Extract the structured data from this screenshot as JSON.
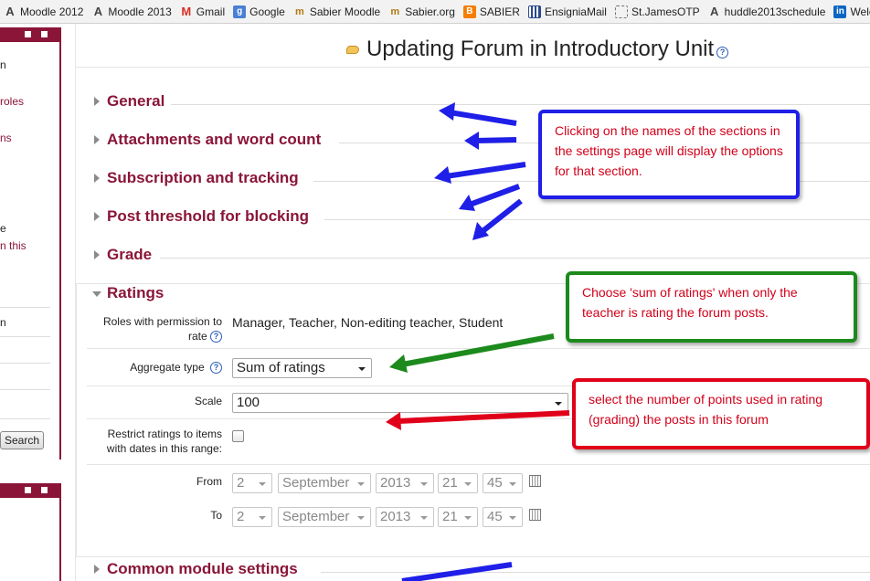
{
  "bookmarks": [
    {
      "label": "Moodle 2012",
      "icon": "moodle-icon"
    },
    {
      "label": "Moodle 2013",
      "icon": "moodle-icon"
    },
    {
      "label": "Gmail",
      "icon": "gmail-icon"
    },
    {
      "label": "Google",
      "icon": "google-icon"
    },
    {
      "label": "Sabier Moodle",
      "icon": "sabier-icon"
    },
    {
      "label": "Sabier.org",
      "icon": "sabier-icon"
    },
    {
      "label": "SABIER",
      "icon": "blogger-icon"
    },
    {
      "label": "EnsigniaMail",
      "icon": "grid-icon"
    },
    {
      "label": "St.JamesOTP",
      "icon": "dotted-box-icon"
    },
    {
      "label": "huddle2013schedule",
      "icon": "moodle-icon"
    },
    {
      "label": "Welcome",
      "icon": "linkedin-icon"
    }
  ],
  "sidebar": {
    "items": [
      {
        "text": "n",
        "style": "dark"
      },
      {
        "text": "roles",
        "style": "link"
      },
      {
        "text": "ns",
        "style": "link"
      },
      {
        "text": "e",
        "style": "dark"
      },
      {
        "text": "n this",
        "style": "link"
      },
      {
        "text": "n",
        "style": "dark"
      }
    ],
    "search_label": "Search"
  },
  "page": {
    "title": "Updating Forum in Introductory Unit",
    "help_glyph": "?"
  },
  "sections": [
    {
      "label": "General",
      "expanded": false
    },
    {
      "label": "Attachments and word count",
      "expanded": false
    },
    {
      "label": "Subscription and tracking",
      "expanded": false
    },
    {
      "label": "Post threshold for blocking",
      "expanded": false
    },
    {
      "label": "Grade",
      "expanded": false
    },
    {
      "label": "Ratings",
      "expanded": true
    },
    {
      "label": "Common module settings",
      "expanded": false
    }
  ],
  "ratings": {
    "roles_label_line1": "Roles with permission to",
    "roles_label_line2": "rate",
    "roles_value": "Manager, Teacher, Non-editing teacher, Student",
    "aggregate_label": "Aggregate type",
    "aggregate_value": "Sum of ratings",
    "scale_label": "Scale",
    "scale_value": "100",
    "restrict_label_line1": "Restrict ratings to items",
    "restrict_label_line2": "with dates in this range:",
    "from_label": "From",
    "to_label": "To",
    "from": {
      "day": "2",
      "month": "September",
      "year": "2013",
      "hour": "21",
      "minute": "45"
    },
    "to": {
      "day": "2",
      "month": "September",
      "year": "2013",
      "hour": "21",
      "minute": "45"
    }
  },
  "callouts": {
    "blue": "Clicking on the names of the sections in the settings page will display the options for that section.",
    "green": "Choose 'sum of ratings' when only the teacher is rating the forum posts.",
    "red": "select the number of points used in rating (grading) the posts in this forum"
  },
  "colors": {
    "accent": "#8a1538",
    "callout_blue": "#1f1fe8",
    "callout_green": "#1c8a1c",
    "callout_red": "#e0001a",
    "callout_text": "#d2001a"
  }
}
